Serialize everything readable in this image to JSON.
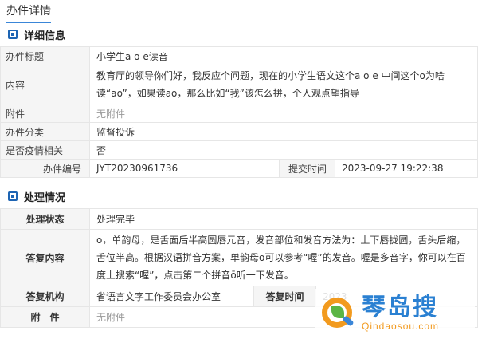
{
  "page_tab": "办件详情",
  "detail": {
    "title": "详细信息",
    "rows": {
      "subject_label": "办件标题",
      "subject_value": "小学生a o e读音",
      "content_label": "内容",
      "content_value": "教育厅的领导你们好，我反应个问题，现在的小学生语文这个a o e 中间这个o为啥读“ao”，如果读ao，那么比如“我”该怎么拼，个人观点望指导",
      "attachment_label": "附件",
      "attachment_value": "无附件",
      "category_label": "办件分类",
      "category_value": "监督投诉",
      "epidemic_label": "是否疫情相关",
      "epidemic_value": "否",
      "number_label": "办件编号",
      "number_value": "JYT20230961736",
      "submit_time_label": "提交时间",
      "submit_time_value": "2023-09-27 19:22:38"
    }
  },
  "process": {
    "title": "处理情况",
    "rows": {
      "status_label": "处理状态",
      "status_value": "处理完毕",
      "reply_label": "答复内容",
      "reply_value": "o，单韵母，是舌面后半高圆唇元音，发音部位和发音方法为：上下唇拢圆，舌头后缩，舌位半高。根据汉语拼音方案，单韵母o可以参考“喔”的发音。喔是多音字，你可以在百度上搜索“喔”，点击第二个拼音ō听一下发音。",
      "agency_label": "答复机构",
      "agency_value": "省语言文字工作委员会办公室",
      "reply_time_label": "答复时间",
      "reply_time_value": "2023",
      "attachment_label": "附　件",
      "attachment_value": "无附件"
    }
  },
  "watermark": {
    "cn": "琴岛搜",
    "url": "Qindaosou.com"
  }
}
